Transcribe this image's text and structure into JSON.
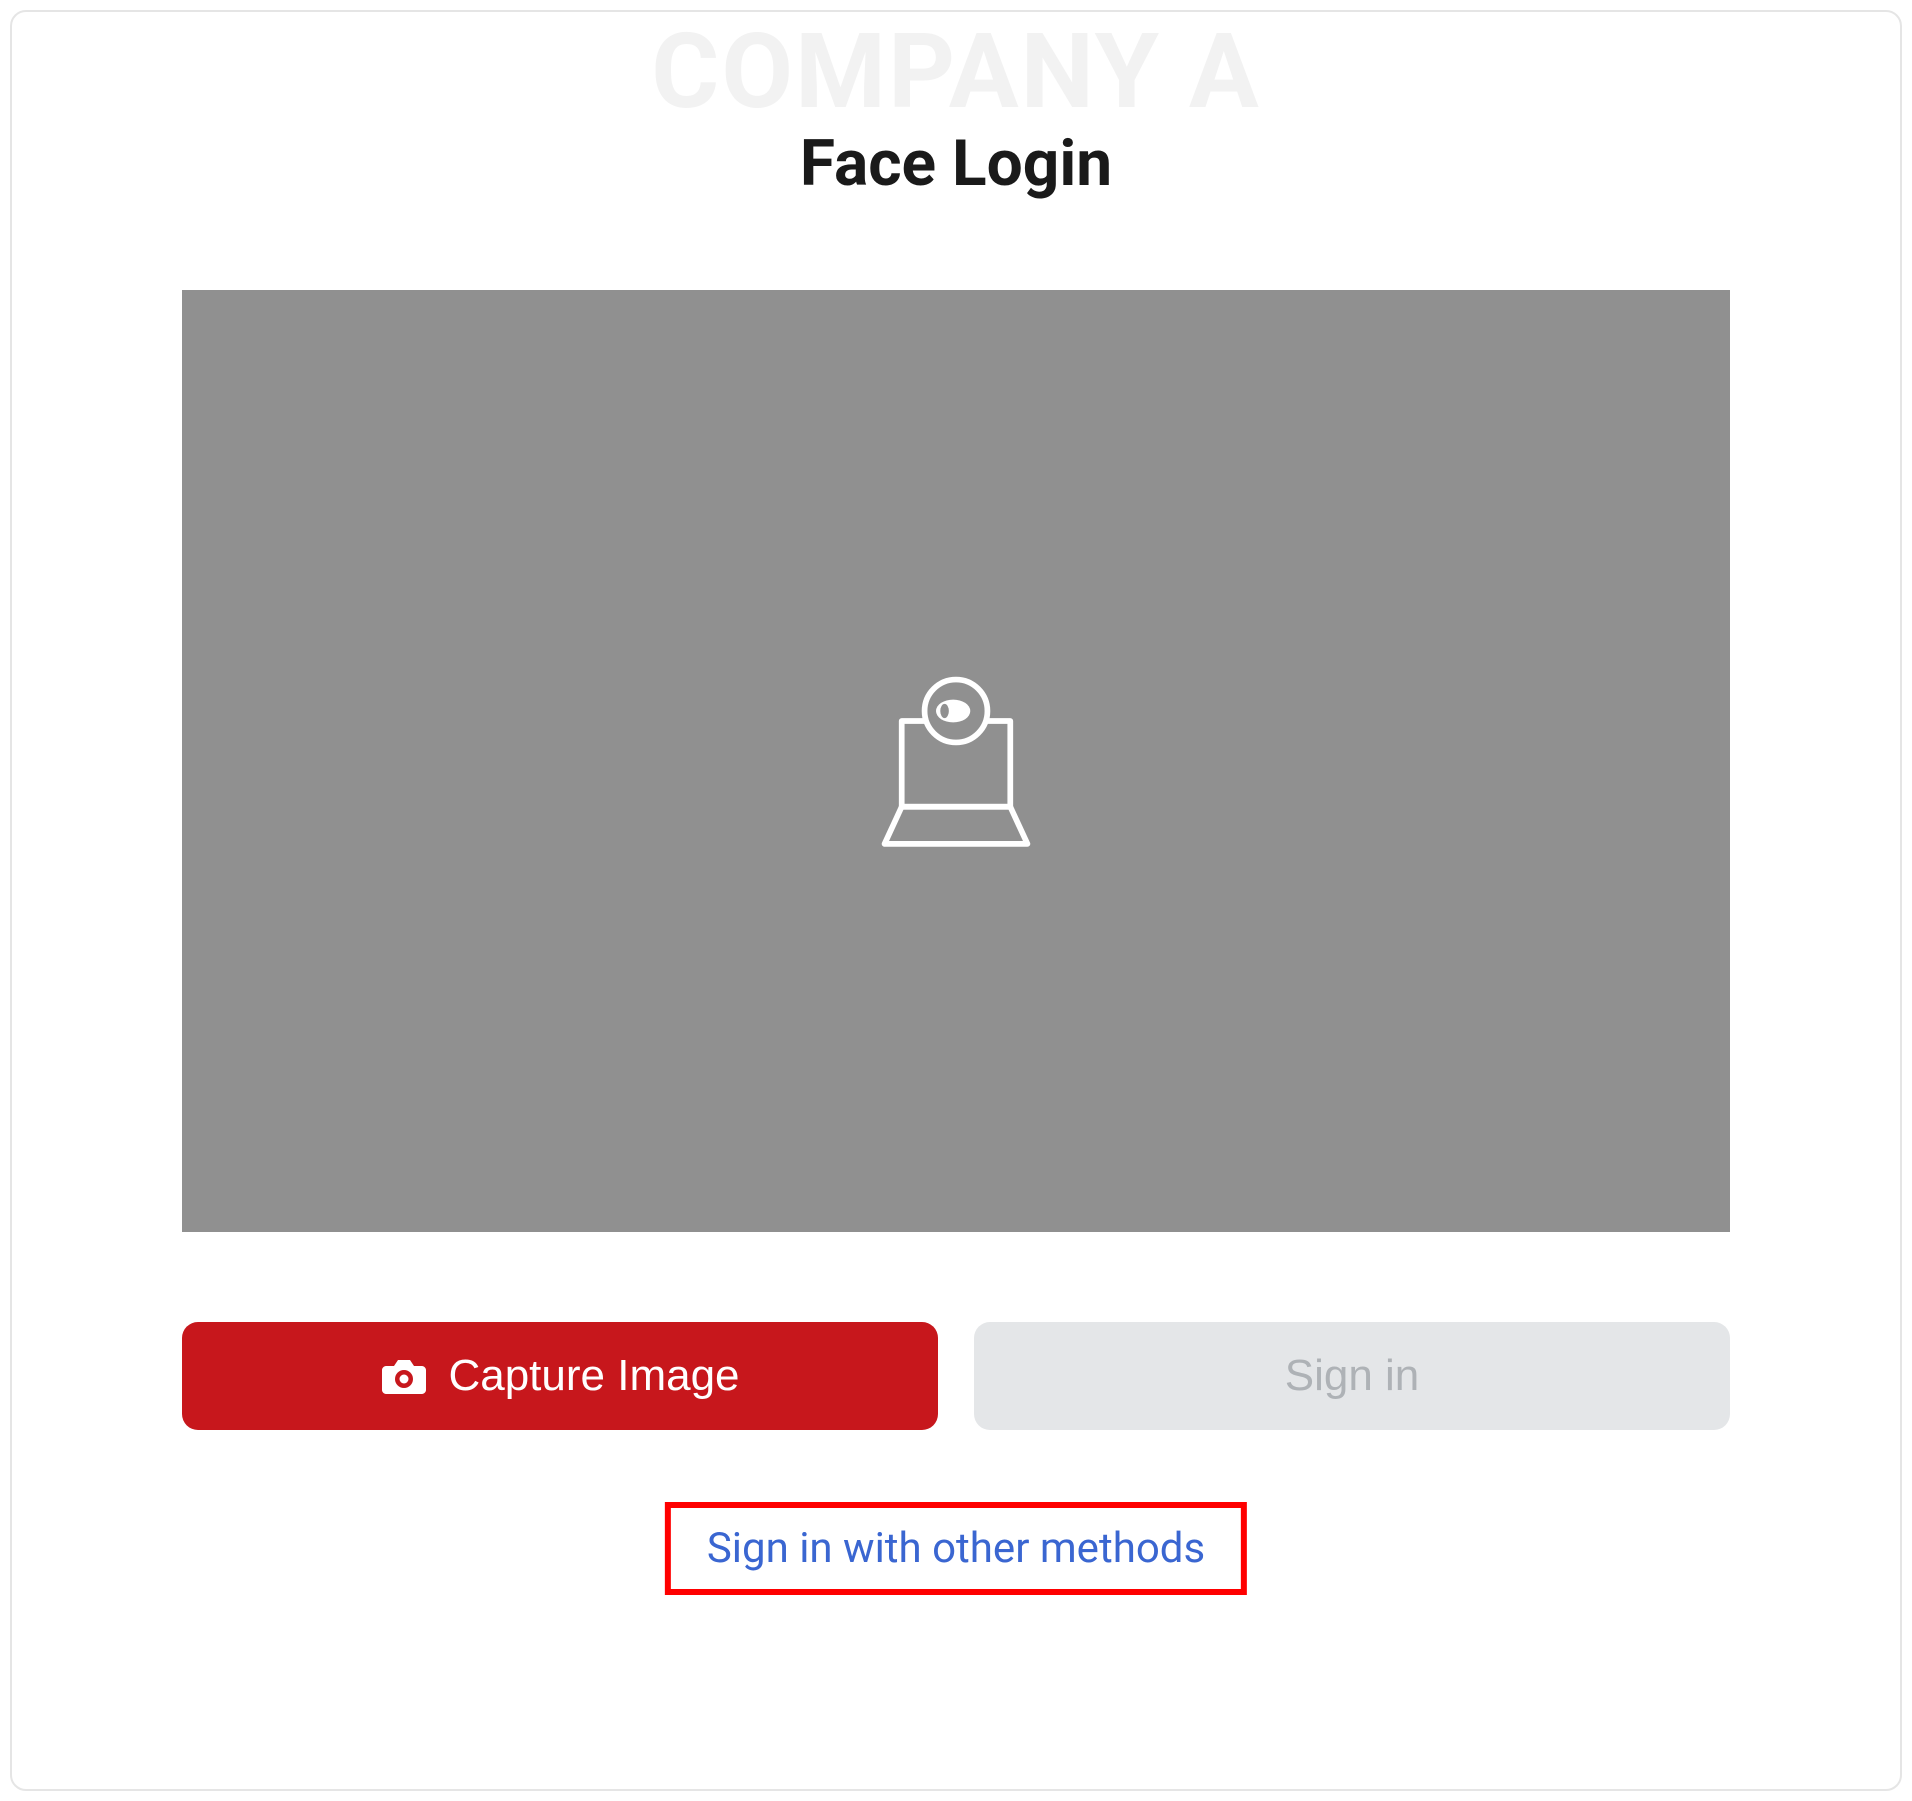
{
  "branding": {
    "company_name": "COMPANY A"
  },
  "header": {
    "title": "Face Login"
  },
  "buttons": {
    "capture_label": "Capture Image",
    "signin_label": "Sign in"
  },
  "links": {
    "other_methods": "Sign in with other methods"
  },
  "colors": {
    "primary": "#c7171c",
    "link": "#3a66d1",
    "disabled_bg": "#e4e6e8",
    "disabled_text": "#aeb2b6",
    "highlight_border": "#ff0000"
  }
}
